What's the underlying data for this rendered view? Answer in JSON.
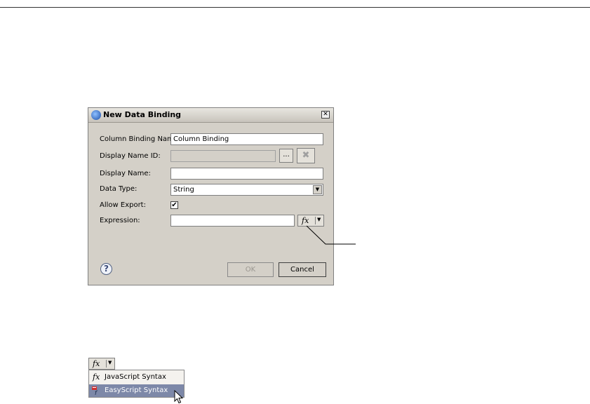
{
  "dialog": {
    "title": "New Data Binding",
    "close_glyph": "✕",
    "fields": {
      "column_binding_name": {
        "label": "Column Binding Name:",
        "value": "Column Binding"
      },
      "display_name_id": {
        "label": "Display Name ID:",
        "value": "",
        "browse_label": "...",
        "clear_glyph": "✖"
      },
      "display_name": {
        "label": "Display Name:",
        "value": ""
      },
      "data_type": {
        "label": "Data Type:",
        "value": "String"
      },
      "allow_export": {
        "label": "Allow Export:",
        "checked": true,
        "check_glyph": "✔"
      },
      "expression": {
        "label": "Expression:",
        "value": ""
      }
    },
    "fx_glyph": "fx",
    "dropdown_glyph": "▼",
    "help_glyph": "?",
    "ok_label": "OK",
    "cancel_label": "Cancel"
  },
  "menu": {
    "fx_glyph": "fx",
    "dropdown_glyph": "▼",
    "items": [
      {
        "label": "JavaScript Syntax",
        "icon": "fx-icon",
        "icon_glyph": "fx"
      },
      {
        "label": "EasyScript Syntax",
        "icon": "easyscript-icon",
        "highlighted": true
      }
    ]
  },
  "colors": {
    "dialog_bg": "#d4d0c8",
    "menu_highlight": "#7d88a8"
  }
}
